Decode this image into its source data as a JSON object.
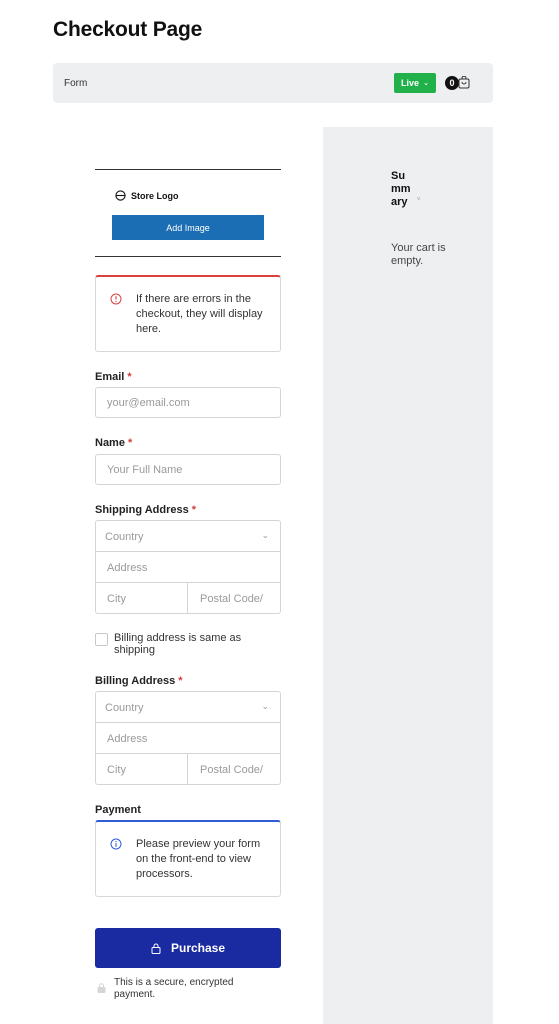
{
  "page": {
    "title": "Checkout Page"
  },
  "form_bar": {
    "label": "Form",
    "live_label": "Live",
    "cart_count": "0"
  },
  "summary": {
    "title": "Summary",
    "empty_text": "Your cart is empty."
  },
  "logo": {
    "store_logo_text": "Store Logo",
    "add_image_label": "Add Image"
  },
  "error_alert": {
    "text": "If there are errors in the checkout, they will display here."
  },
  "email": {
    "label": "Email",
    "required_mark": "*",
    "placeholder": "your@email.com"
  },
  "name": {
    "label": "Name",
    "required_mark": "*",
    "placeholder": "Your Full Name"
  },
  "shipping": {
    "label": "Shipping Address",
    "required_mark": "*",
    "country_placeholder": "Country",
    "address_placeholder": "Address",
    "city_placeholder": "City",
    "postal_placeholder": "Postal Code/"
  },
  "billing_same": {
    "label": "Billing address is same as shipping",
    "checked": false
  },
  "billing": {
    "label": "Billing Address",
    "required_mark": "*",
    "country_placeholder": "Country",
    "address_placeholder": "Address",
    "city_placeholder": "City",
    "postal_placeholder": "Postal Code/"
  },
  "payment": {
    "label": "Payment",
    "info_text": "Please preview your form on the front-end to view processors."
  },
  "purchase": {
    "label": "Purchase"
  },
  "secure_note": {
    "text": "This is a secure, encrypted payment."
  },
  "colors": {
    "live_green": "#21b14b",
    "add_image_blue": "#1b6eb3",
    "purchase_blue": "#1a2aa0",
    "error_red": "#d94040",
    "info_blue": "#2f5dd6",
    "panel_gray": "#eeeff1"
  },
  "icons": {
    "store_logo": "store-logo-icon",
    "error": "error-circle-icon",
    "info": "info-circle-icon",
    "cart": "cart-icon",
    "lock": "lock-icon"
  }
}
